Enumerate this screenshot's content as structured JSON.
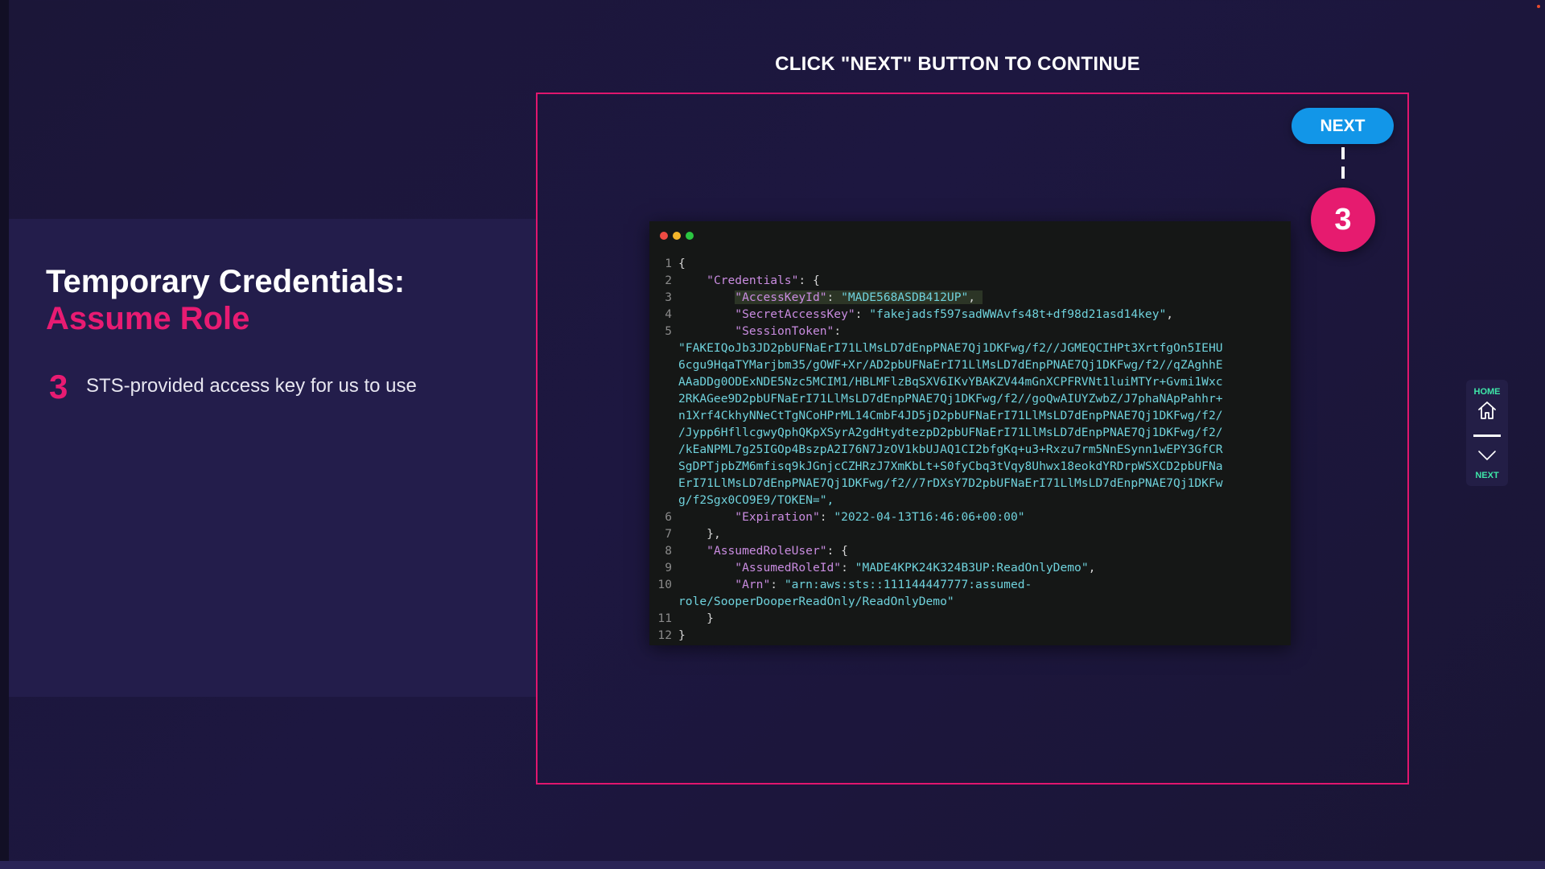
{
  "header": {
    "instruction": "CLICK \"NEXT\" BUTTON TO CONTINUE"
  },
  "lesson": {
    "title_line1": "Temporary Credentials:",
    "title_line2": "Assume Role",
    "step_number": "3",
    "step_text": "STS-provided access key for us to use"
  },
  "next_button": {
    "label": "NEXT"
  },
  "step_badge": "3",
  "side_nav": {
    "home_label": "HOME",
    "next_label": "NEXT"
  },
  "colors": {
    "accent_pink": "#e81b72",
    "button_blue": "#1296e8",
    "nav_green": "#3ee7a8"
  },
  "code": {
    "ln1": "1",
    "ln2": "2",
    "ln3": "3",
    "ln4": "4",
    "ln5": "5",
    "ln6": "6",
    "ln7": "7",
    "ln8": "8",
    "ln9": "9",
    "ln10": "10",
    "ln11": "11",
    "ln12": "12",
    "open_brace": "{",
    "credentials_key": "\"Credentials\"",
    "access_key_id_key": "\"AccessKeyId\"",
    "access_key_id_value": "\"MADE568ASDB412UP\"",
    "secret_access_key_key": "\"SecretAccessKey\"",
    "secret_access_key_value": "\"fakejadsf597sadWWAvfs48t+df98d21asd14key\"",
    "session_token_key": "\"SessionToken\"",
    "session_token_lines": [
      "\"FAKEIQoJb3JD2pbUFNaErI71LlMsLD7dEnpPNAE7Qj1DKFwg/f2//JGMEQCIHPt3XrtfgOn5IEHU",
      "6cgu9HqaTYMarjbm35/gOWF+Xr/AD2pbUFNaErI71LlMsLD7dEnpPNAE7Qj1DKFwg/f2//qZAghhE",
      "AAaDDg0ODExNDE5Nzc5MCIM1/HBLMFlzBqSXV6IKvYBAKZV44mGnXCPFRVNt1luiMTYr+Gvmi1Wxc",
      "2RKAGee9D2pbUFNaErI71LlMsLD7dEnpPNAE7Qj1DKFwg/f2//goQwAIUYZwbZ/J7phaNApPahhr+",
      "n1Xrf4CkhyNNeCtTgNCoHPrML14CmbF4JD5jD2pbUFNaErI71LlMsLD7dEnpPNAE7Qj1DKFwg/f2/",
      "/Jypp6HfllcgwyQphQKpXSyrA2gdHtydtezpD2pbUFNaErI71LlMsLD7dEnpPNAE7Qj1DKFwg/f2/",
      "/kEaNPML7g25IGOp4BszpA2I76N7JzOV1kbUJAQ1CI2bfgKq+u3+Rxzu7rm5NnESynn1wEPY3GfCR",
      "SgDPTjpbZM6mfisq9kJGnjcCZHRzJ7XmKbLt+S0fyCbq3tVqy8Uhwx18eokdYRDrpWSXCD2pbUFNa",
      "ErI71LlMsLD7dEnpPNAE7Qj1DKFwg/f2//7rDXsY7D2pbUFNaErI71LlMsLD7dEnpPNAE7Qj1DKFw",
      "g/f2Sgx0CO9E9/TOKEN=\","
    ],
    "expiration_key": "\"Expiration\"",
    "expiration_value": "\"2022-04-13T16:46:06+00:00\"",
    "close_credentials": "},",
    "assumed_role_user_key": "\"AssumedRoleUser\"",
    "assumed_role_id_key": "\"AssumedRoleId\"",
    "assumed_role_id_value": "\"MADE4KPK24K324B3UP:ReadOnlyDemo\"",
    "arn_key": "\"Arn\"",
    "arn_value_line1": "\"arn:aws:sts::111144447777:assumed-",
    "arn_value_line2": "role/SooperDooperReadOnly/ReadOnlyDemo\"",
    "close_assumed": "}",
    "close_brace": "}"
  }
}
